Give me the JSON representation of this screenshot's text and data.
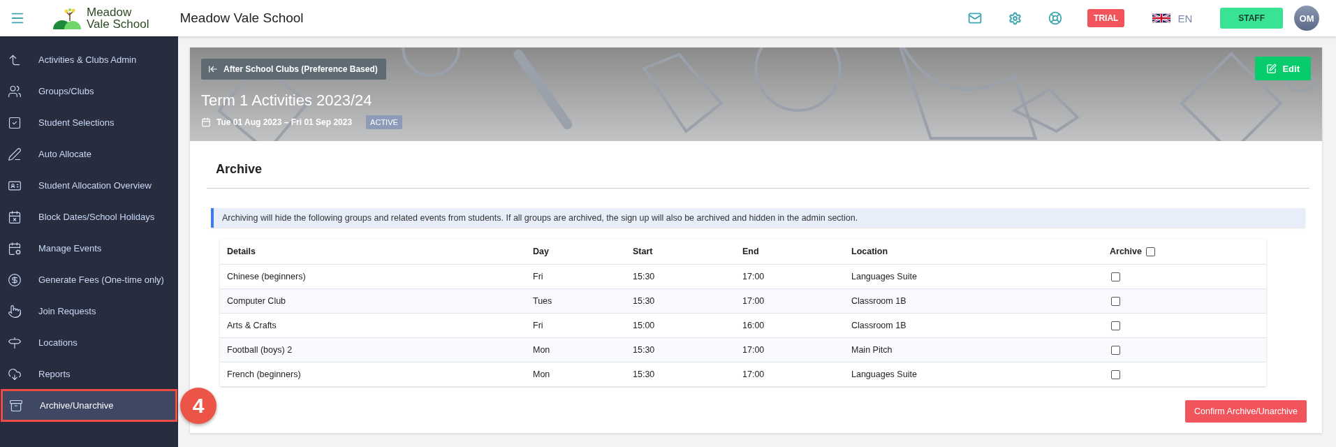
{
  "header": {
    "logo_text": [
      "Meadow",
      "Vale School"
    ],
    "school_name": "Meadow Vale School",
    "trial_badge": "TRIAL",
    "language": "EN",
    "role_button": "STAFF",
    "avatar_initials": "OM"
  },
  "sidebar": {
    "items": [
      {
        "label": "Activities & Clubs Admin",
        "selected": false
      },
      {
        "label": "Groups/Clubs",
        "selected": false
      },
      {
        "label": "Student Selections",
        "selected": false
      },
      {
        "label": "Auto Allocate",
        "selected": false
      },
      {
        "label": "Student Allocation Overview",
        "selected": false
      },
      {
        "label": "Block Dates/School Holidays",
        "selected": false
      },
      {
        "label": "Manage Events",
        "selected": false
      },
      {
        "label": "Generate Fees (One-time only)",
        "selected": false
      },
      {
        "label": "Join Requests",
        "selected": false
      },
      {
        "label": "Locations",
        "selected": false
      },
      {
        "label": "Reports",
        "selected": false
      },
      {
        "label": "Archive/Unarchive",
        "selected": true
      }
    ]
  },
  "callout": {
    "number": "4"
  },
  "banner": {
    "back_button": "After School Clubs (Preference Based)",
    "edit_button": "Edit",
    "title": "Term 1 Activities 2023/24",
    "dates": "Tue 01 Aug 2023 – Fri 01 Sep 2023",
    "status": "ACTIVE"
  },
  "section": {
    "title": "Archive",
    "info": "Archiving will hide the following groups and related events from students. If all groups are archived, the sign up will also be archived and hidden in the admin section."
  },
  "table": {
    "columns": [
      "Details",
      "Day",
      "Start",
      "End",
      "Location",
      "Archive"
    ],
    "select_all_checked": false,
    "rows": [
      {
        "cells": [
          "Chinese (beginners)",
          "Fri",
          "15:30",
          "17:00",
          "Languages Suite"
        ],
        "checked": false
      },
      {
        "cells": [
          "Computer Club",
          "Tues",
          "15:30",
          "17:00",
          "Classroom 1B"
        ],
        "checked": false
      },
      {
        "cells": [
          "Arts & Crafts",
          "Fri",
          "15:00",
          "16:00",
          "Classroom 1B"
        ],
        "checked": false
      },
      {
        "cells": [
          "Football (boys) 2",
          "Mon",
          "15:30",
          "17:00",
          "Main Pitch"
        ],
        "checked": false
      },
      {
        "cells": [
          "French (beginners)",
          "Mon",
          "15:30",
          "17:00",
          "Languages Suite"
        ],
        "checked": false
      }
    ]
  },
  "confirm_button": "Confirm Archive/Unarchive"
}
